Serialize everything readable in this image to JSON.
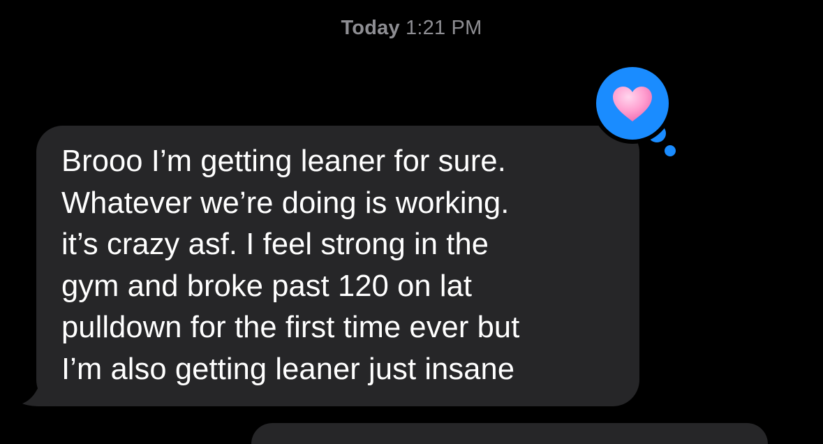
{
  "conversation": {
    "timestamp": {
      "day": "Today",
      "time": "1:21 PM"
    },
    "messages": [
      {
        "direction": "incoming",
        "text": "Brooo I’m getting leaner for sure.\nWhatever we’re doing is working.\nit’s crazy asf. I feel strong in the\ngym and broke past 120 on lat\npulldown for the first time ever but\nI’m also getting leaner just insane",
        "tapback": {
          "icon": "heart-icon",
          "color": "#1a8cff"
        }
      }
    ]
  },
  "colors": {
    "background": "#000000",
    "incoming_bubble": "#262628",
    "timestamp_text": "#8e8e93",
    "tapback_blue": "#1a8cff",
    "heart_pink": "#ff9ecf"
  }
}
